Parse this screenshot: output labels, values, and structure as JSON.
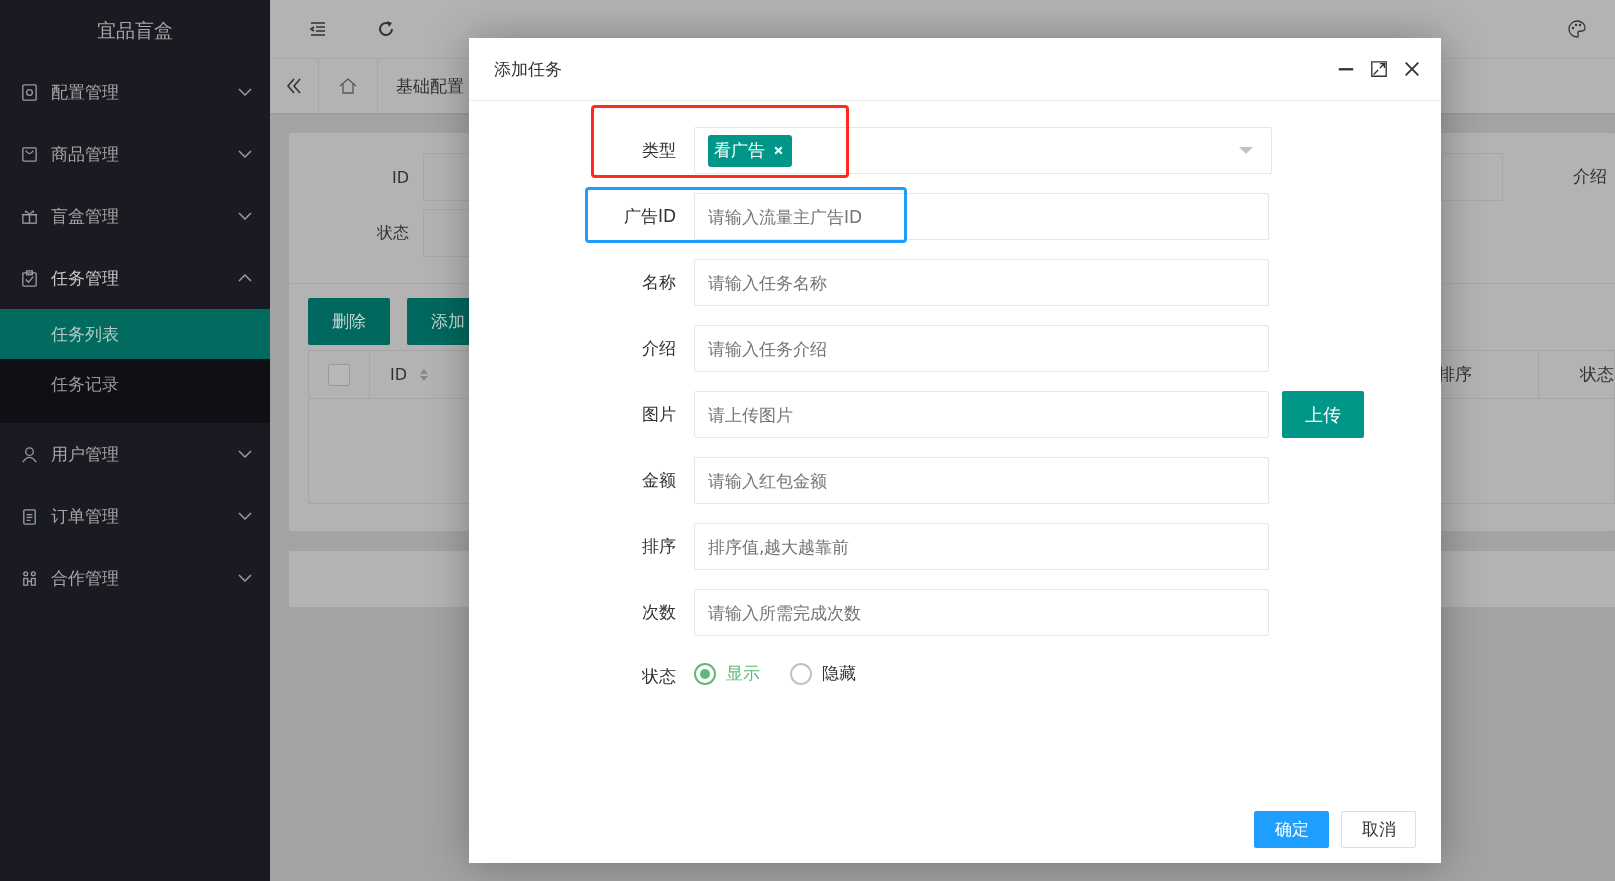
{
  "app": {
    "title": "宜品盲盒"
  },
  "sidebar": {
    "items": [
      {
        "label": "配置管理",
        "expanded": false
      },
      {
        "label": "商品管理",
        "expanded": false
      },
      {
        "label": "盲盒管理",
        "expanded": false
      },
      {
        "label": "任务管理",
        "expanded": true,
        "children": [
          {
            "label": "任务列表",
            "selected": true
          },
          {
            "label": "任务记录",
            "selected": false
          }
        ]
      },
      {
        "label": "用户管理",
        "expanded": false
      },
      {
        "label": "订单管理",
        "expanded": false
      },
      {
        "label": "合作管理",
        "expanded": false
      }
    ]
  },
  "tabs": [
    {
      "label": "基础配置"
    }
  ],
  "search_form": {
    "fields": [
      {
        "label": "ID"
      },
      {
        "label": "状态"
      }
    ],
    "right_label": "介绍"
  },
  "toolbar_buttons": [
    "删除",
    "添加"
  ],
  "table": {
    "select_all_checked": false,
    "columns": [
      {
        "label": "ID"
      },
      {
        "label": "排序"
      },
      {
        "label": "状态"
      }
    ]
  },
  "dialog": {
    "title": "添加任务",
    "fields": [
      {
        "kind": "select",
        "label": "类型",
        "tags": [
          "看广告"
        ],
        "color": "#ff2a1a"
      },
      {
        "kind": "input",
        "label": "广告ID",
        "placeholder": "请输入流量主广告ID",
        "color": "#1e9fff"
      },
      {
        "kind": "input",
        "label": "名称",
        "placeholder": "请输入任务名称"
      },
      {
        "kind": "input",
        "label": "介绍",
        "placeholder": "请输入任务介绍"
      },
      {
        "kind": "upload",
        "label": "图片",
        "placeholder": "请上传图片",
        "button": "上传"
      },
      {
        "kind": "input",
        "label": "金额",
        "placeholder": "请输入红包金额"
      },
      {
        "kind": "input",
        "label": "排序",
        "placeholder": "排序值,越大越靠前"
      },
      {
        "kind": "input",
        "label": "次数",
        "placeholder": "请输入所需完成次数"
      },
      {
        "kind": "radio",
        "label": "状态",
        "options": [
          {
            "label": "显示",
            "selected": true
          },
          {
            "label": "隐藏",
            "selected": false
          }
        ]
      }
    ],
    "buttons": [
      "确定",
      "取消"
    ]
  }
}
